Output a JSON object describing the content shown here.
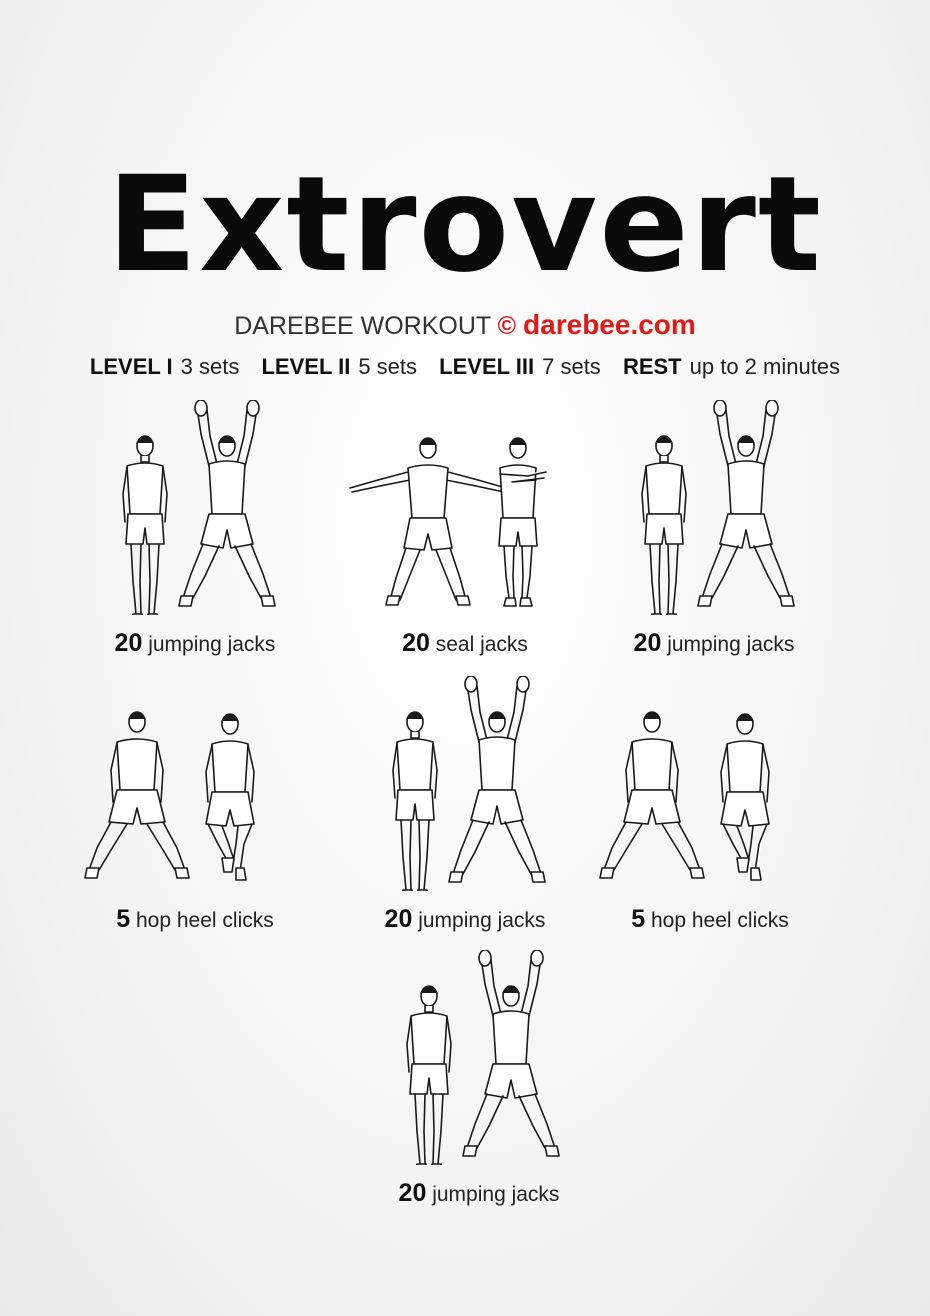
{
  "title": "Extrovert",
  "subtitle": {
    "prefix": "DAREBEE WORKOUT",
    "copyright": "©",
    "site": "darebee.com"
  },
  "levels": [
    {
      "label": "LEVEL I",
      "value": "3 sets"
    },
    {
      "label": "LEVEL II",
      "value": "5 sets"
    },
    {
      "label": "LEVEL III",
      "value": "7 sets"
    },
    {
      "label": "REST",
      "value": "up to 2 minutes"
    }
  ],
  "exercises": [
    {
      "reps": "20",
      "name": "jumping jacks",
      "illustration": "jumping-jacks"
    },
    {
      "reps": "20",
      "name": "seal jacks",
      "illustration": "seal-jacks"
    },
    {
      "reps": "20",
      "name": "jumping jacks",
      "illustration": "jumping-jacks"
    },
    {
      "reps": "5",
      "name": "hop heel clicks",
      "illustration": "hop-heel-clicks"
    },
    {
      "reps": "20",
      "name": "jumping jacks",
      "illustration": "jumping-jacks"
    },
    {
      "reps": "5",
      "name": "hop heel clicks",
      "illustration": "hop-heel-clicks"
    },
    {
      "reps": "20",
      "name": "jumping jacks",
      "illustration": "jumping-jacks"
    }
  ]
}
